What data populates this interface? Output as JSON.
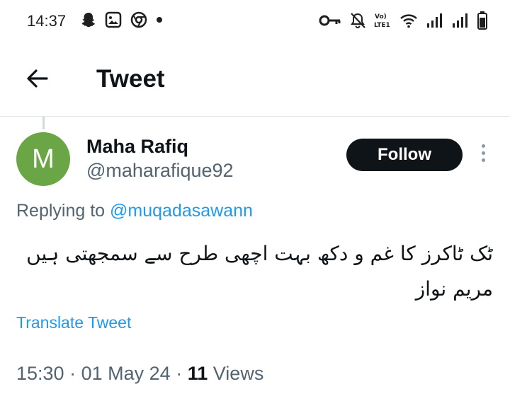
{
  "status_bar": {
    "time": "14:37",
    "left_icons": [
      "snapchat-icon",
      "gallery-icon",
      "chrome-icon",
      "notification-dot-icon"
    ],
    "right_icons": [
      "key-icon",
      "bell-off-icon",
      "volte-icon",
      "wifi-icon",
      "signal-icon",
      "signal-icon",
      "battery-icon"
    ],
    "volte_text": "Vo) LTE1"
  },
  "header": {
    "back_icon": "arrow-left-icon",
    "title": "Tweet"
  },
  "tweet": {
    "avatar_letter": "M",
    "avatar_color": "#6aa645",
    "author_name": "Maha Rafiq",
    "author_handle": "@maharafique92",
    "follow_label": "Follow",
    "more_icon": "more-vertical-icon",
    "replying_prefix": "Replying to",
    "replying_to": "@muqadasawann",
    "text_line1": "ٹک ٹاکرز کا غم و دکھ بہت اچھی طرح سے سمجھتی ہیں",
    "text_line2": "مریم نواز",
    "translate_label": "Translate Tweet",
    "time": "15:30",
    "separator": "·",
    "date": "01 May 24",
    "views_count": "11",
    "views_label": "Views"
  },
  "colors": {
    "link": "#1d9bf0",
    "secondary_text": "#536471",
    "follow_bg": "#0f1419"
  }
}
